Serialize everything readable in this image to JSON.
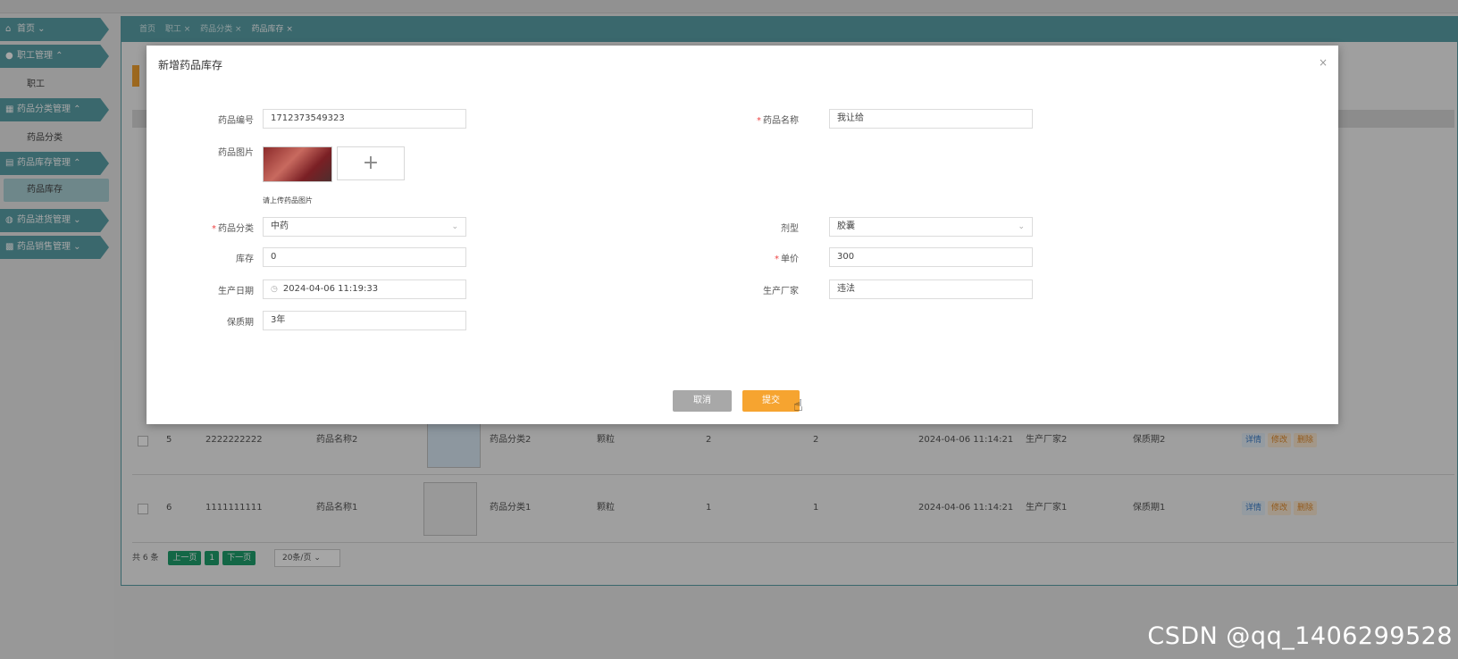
{
  "sidebar": {
    "groups": [
      {
        "label": "首页 ⌄",
        "icon": "home-icon"
      },
      {
        "label": "职工管理 ⌃",
        "icon": "user-icon"
      },
      {
        "sub": "职工"
      },
      {
        "label": "药品分类管理 ⌃",
        "icon": "grid-icon"
      },
      {
        "sub": "药品分类"
      },
      {
        "label": "药品库存管理 ⌃",
        "icon": "box-icon"
      },
      {
        "sub_active": "药品库存"
      },
      {
        "label": "药品进货管理 ⌄",
        "icon": "cart-icon"
      },
      {
        "label": "药品销售管理 ⌄",
        "icon": "sale-icon"
      }
    ]
  },
  "breadcrumb": {
    "items": [
      "首页",
      "职工 ×",
      "药品分类 ×",
      "药品库存 ×"
    ]
  },
  "table": {
    "rows": [
      {
        "no": "5",
        "code": "2222222222",
        "name": "药品名称2",
        "category": "药品分类2",
        "form": "颗粒",
        "stock": "2",
        "price": "2",
        "date": "2024-04-06 11:14:21",
        "maker": "生产厂家2",
        "shelf": "保质期2"
      },
      {
        "no": "6",
        "code": "1111111111",
        "name": "药品名称1",
        "category": "药品分类1",
        "form": "颗粒",
        "stock": "1",
        "price": "1",
        "date": "2024-04-06 11:14:21",
        "maker": "生产厂家1",
        "shelf": "保质期1"
      }
    ],
    "actions": {
      "detail": "详情",
      "edit": "修改",
      "delete": "删除"
    }
  },
  "pager": {
    "total": "共 6 条",
    "prev": "上一页",
    "page": "1",
    "next": "下一页",
    "size": "20条/页 ⌄"
  },
  "dialog": {
    "title": "新增药品库存",
    "close": "×",
    "fields": {
      "code_label": "药品编号",
      "code_value": "1712373549323",
      "name_label": "药品名称",
      "name_value": "我让给",
      "image_label": "药品图片",
      "upload_plus": "+",
      "upload_hint": "请上传药品图片",
      "category_label": "药品分类",
      "category_value": "中药",
      "form_label": "剂型",
      "form_value": "胶囊",
      "stock_label": "库存",
      "stock_value": "0",
      "price_label": "单价",
      "price_value": "300",
      "date_label": "生产日期",
      "date_value": "2024-04-06 11:19:33",
      "maker_label": "生产厂家",
      "maker_value": "违法",
      "shelf_label": "保质期",
      "shelf_value": "3年"
    },
    "cancel": "取消",
    "submit": "提交"
  },
  "watermark": "CSDN @qq_1406299528"
}
